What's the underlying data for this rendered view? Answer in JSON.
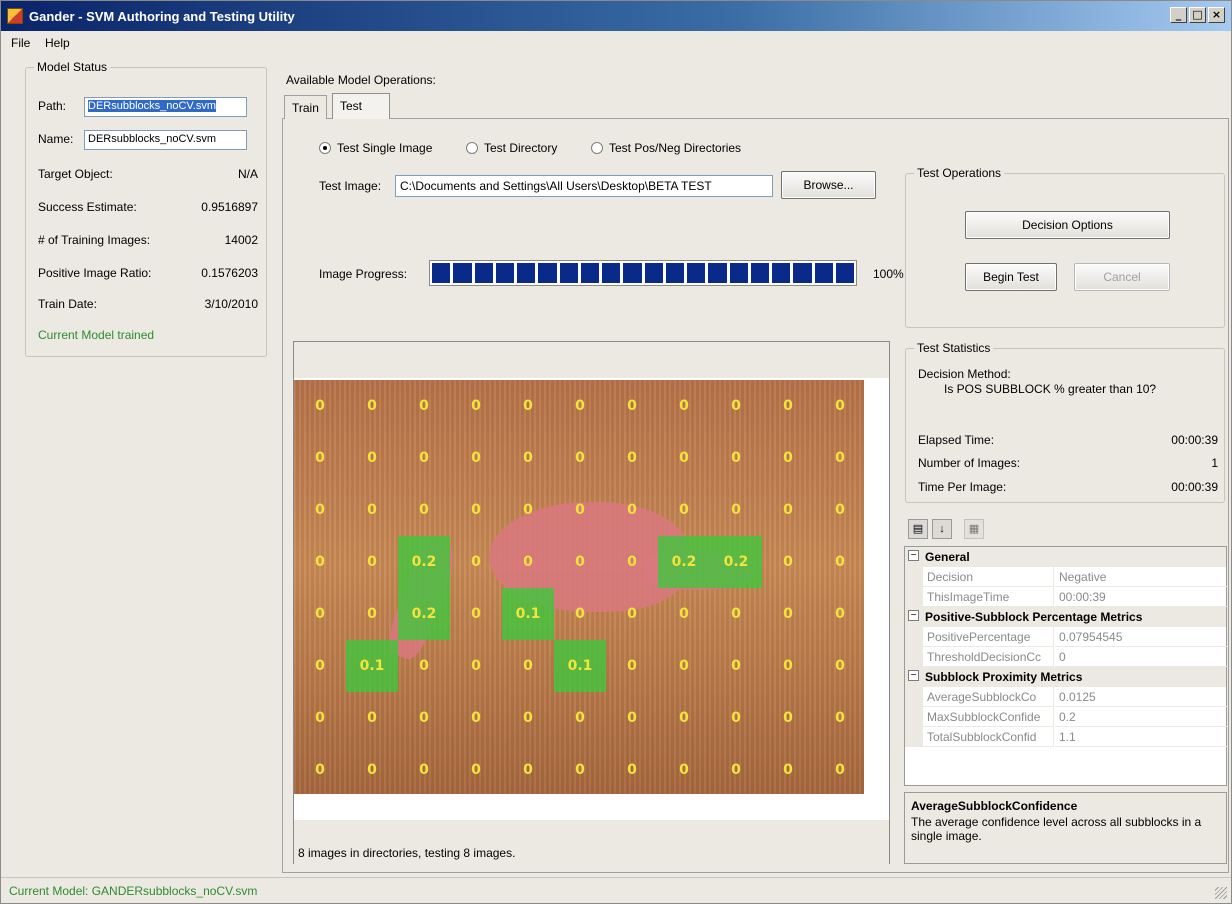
{
  "window": {
    "title": "Gander - SVM Authoring and Testing Utility"
  },
  "menu": {
    "file": "File",
    "help": "Help"
  },
  "model_status": {
    "legend": "Model Status",
    "path_label": "Path:",
    "path_value": "DERsubblocks_noCV.svm",
    "name_label": "Name:",
    "name_value": "DERsubblocks_noCV.svm",
    "target_label": "Target Object:",
    "target_value": "N/A",
    "success_label": "Success Estimate:",
    "success_value": "0.9516897",
    "training_label": "# of Training Images:",
    "training_value": "14002",
    "positive_label": "Positive Image Ratio:",
    "positive_value": "0.1576203",
    "date_label": "Train Date:",
    "date_value": "3/10/2010",
    "status_text": "Current Model trained"
  },
  "operations": {
    "label": "Available Model Operations:",
    "tabs": [
      "Train",
      "Test"
    ],
    "active_tab": "Test",
    "radios": [
      "Test Single Image",
      "Test Directory",
      "Test Pos/Neg Directories"
    ],
    "selected_radio": "Test Single Image",
    "test_image_label": "Test Image:",
    "test_image_value": "C:\\Documents and Settings\\All Users\\Desktop\\BETA TEST",
    "browse_label": "Browse...",
    "progress_label": "Image Progress:",
    "progress_value": 1.0,
    "progress_text": "100%",
    "status_text": "8 images in directories, testing 8 images."
  },
  "test_operations": {
    "legend": "Test Operations",
    "decision_options": "Decision Options",
    "begin_test": "Begin Test",
    "cancel": "Cancel"
  },
  "test_statistics": {
    "legend": "Test Statistics",
    "method_label": "Decision Method:",
    "method_value": "Is POS SUBBLOCK % greater than 10?",
    "elapsed_label": "Elapsed Time:",
    "elapsed_value": "00:00:39",
    "count_label": "Number of Images:",
    "count_value": "1",
    "per_image_label": "Time Per Image:",
    "per_image_value": "00:00:39"
  },
  "property_grid": {
    "categories": [
      {
        "name": "General",
        "props": [
          {
            "key": "Decision",
            "value": "Negative"
          },
          {
            "key": "ThisImageTime",
            "value": "00:00:39"
          }
        ]
      },
      {
        "name": "Positive-Subblock Percentage Metrics",
        "props": [
          {
            "key": "PositivePercentage",
            "value": "0.07954545"
          },
          {
            "key": "ThresholdDecisionCc",
            "value": "0"
          }
        ]
      },
      {
        "name": "Subblock Proximity Metrics",
        "props": [
          {
            "key": "AverageSubblockCo",
            "value": "0.0125"
          },
          {
            "key": "MaxSubblockConfide",
            "value": "0.2"
          },
          {
            "key": "TotalSubblockConfid",
            "value": "1.1"
          }
        ]
      }
    ],
    "desc_title": "AverageSubblockConfidence",
    "desc_text": "The average confidence level across all subblocks in a single image."
  },
  "subblock_grid": [
    [
      "0",
      "0",
      "0",
      "0",
      "0",
      "0",
      "0",
      "0",
      "0",
      "0",
      "0"
    ],
    [
      "0",
      "0",
      "0",
      "0",
      "0",
      "0",
      "0",
      "0",
      "0",
      "0",
      "0"
    ],
    [
      "0",
      "0",
      "0",
      "0",
      "0",
      "0",
      "0",
      "0",
      "0",
      "0",
      "0"
    ],
    [
      "0",
      "0",
      "0.2",
      "0",
      "0",
      "0",
      "0",
      "0.2",
      "0.2",
      "0",
      "0"
    ],
    [
      "0",
      "0",
      "0.2",
      "0",
      "0.1",
      "0",
      "0",
      "0",
      "0",
      "0",
      "0"
    ],
    [
      "0",
      "0.1",
      "0",
      "0",
      "0",
      "0.1",
      "0",
      "0",
      "0",
      "0",
      "0"
    ],
    [
      "0",
      "0",
      "0",
      "0",
      "0",
      "0",
      "0",
      "0",
      "0",
      "0",
      "0"
    ],
    [
      "0",
      "0",
      "0",
      "0",
      "0",
      "0",
      "0",
      "0",
      "0",
      "0",
      "0"
    ]
  ],
  "status_bar": {
    "text": "Current Model: GANDERsubblocks_noCV.svm"
  },
  "colors": {
    "title_bar": "#0a246a",
    "progress": "#0a2a8a",
    "trained_text": "#2e8b2e",
    "positive_block": "#3cc83c",
    "block_number": "#f2e43a"
  }
}
